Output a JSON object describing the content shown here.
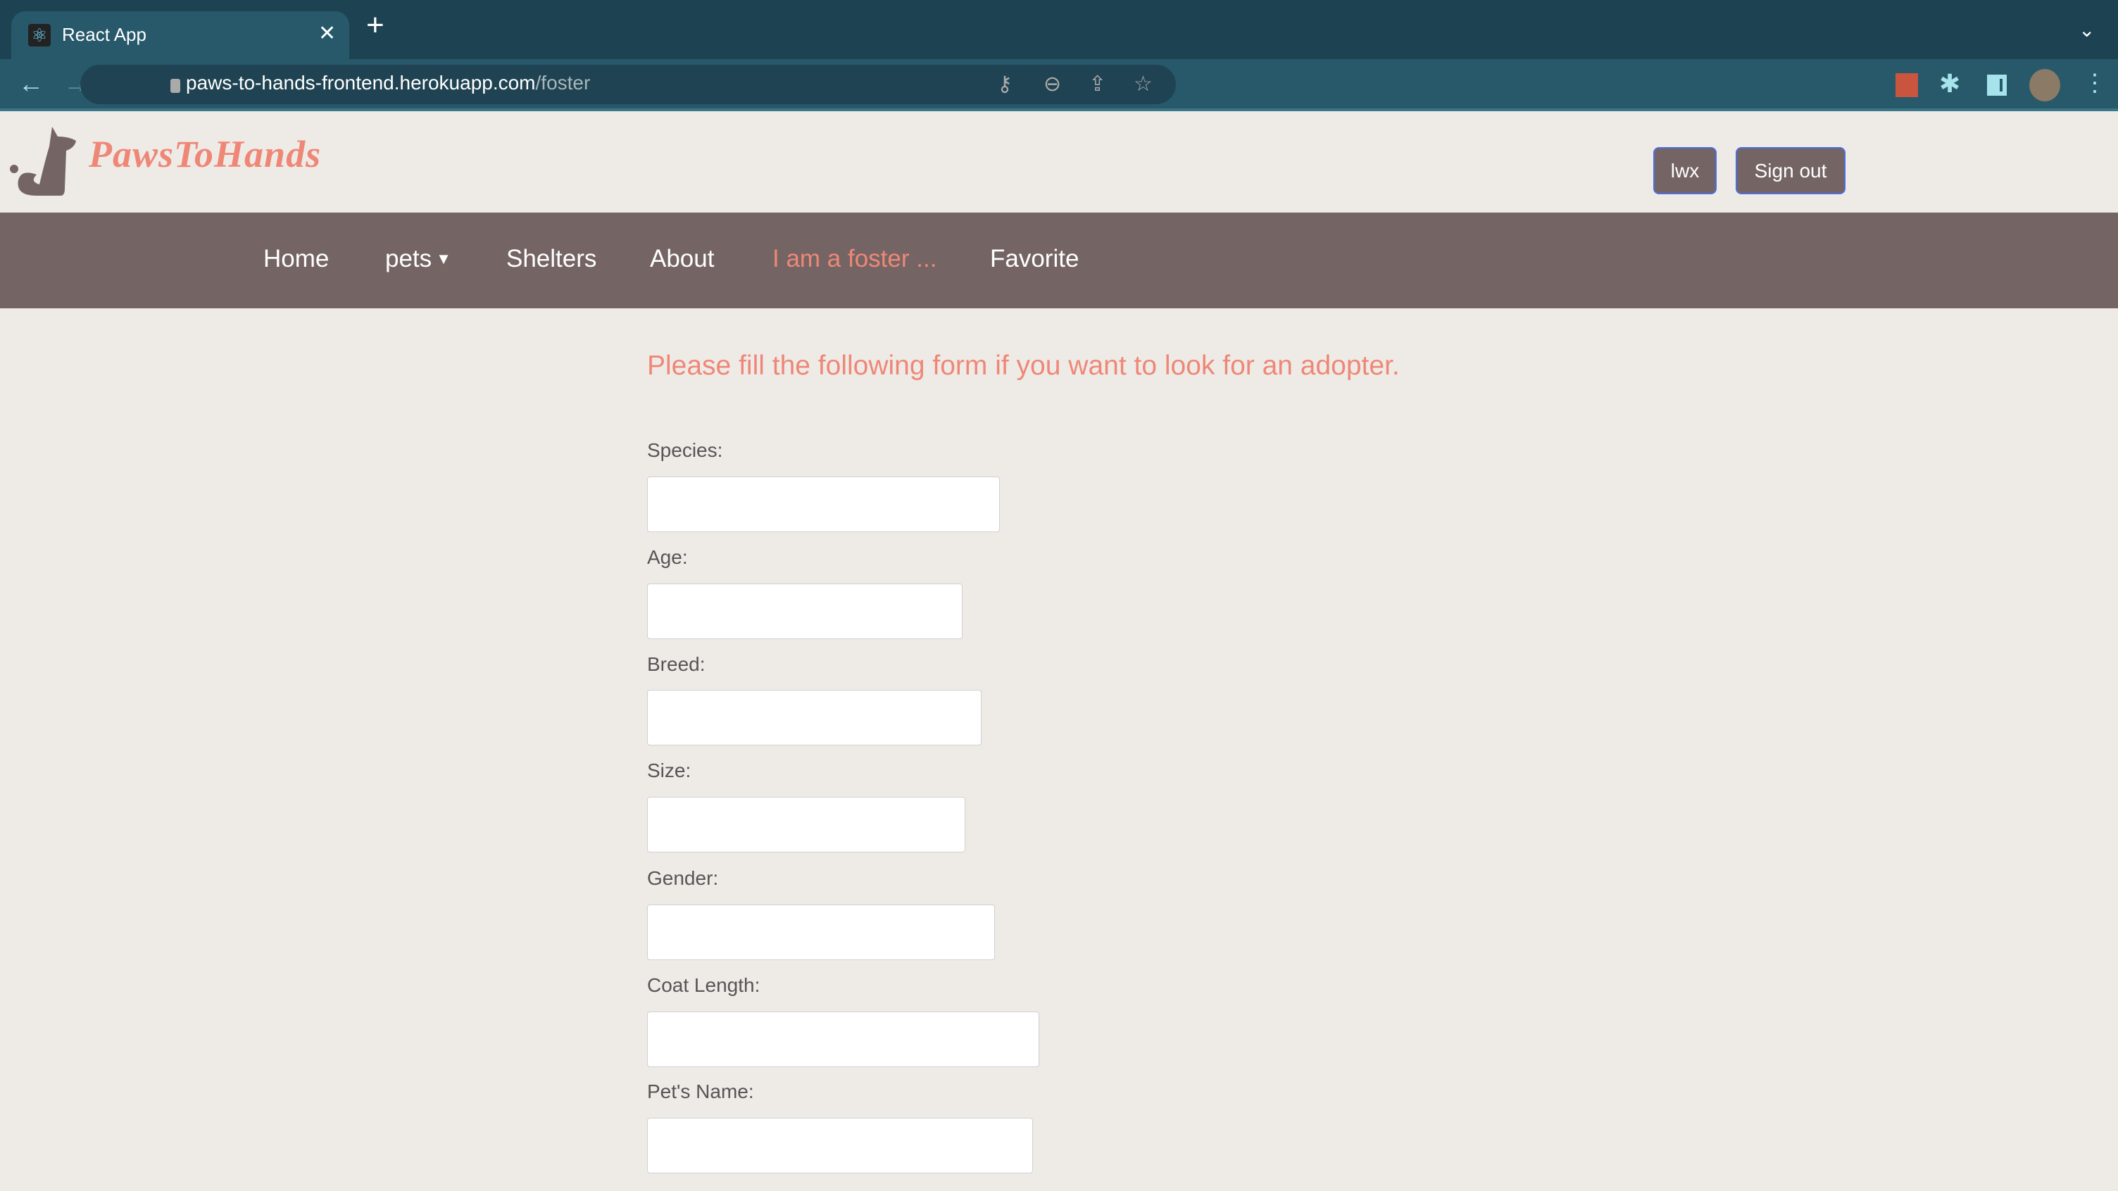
{
  "browser": {
    "tab_title": "React App",
    "url_host": "paws-to-hands-frontend.herokuapp.com",
    "url_path": "/foster"
  },
  "header": {
    "brand": "PawsToHands",
    "user_button": "lwx",
    "signout_button": "Sign out"
  },
  "nav": {
    "items": [
      "Home",
      "pets",
      "Shelters",
      "About",
      "I am a foster ...",
      "Favorite"
    ],
    "active": "I am a foster ..."
  },
  "form": {
    "heading": "Please fill the following form if you want to look for an adopter.",
    "fields": [
      {
        "label": "Species:",
        "value": ""
      },
      {
        "label": "Age:",
        "value": ""
      },
      {
        "label": "Breed:",
        "value": ""
      },
      {
        "label": "Size:",
        "value": ""
      },
      {
        "label": "Gender:",
        "value": ""
      },
      {
        "label": "Coat Length:",
        "value": ""
      },
      {
        "label": "Pet's Name:",
        "value": ""
      }
    ]
  },
  "colors": {
    "accent": "#ef8777",
    "nav_bg": "#746564",
    "page_bg": "#eeebe7"
  }
}
